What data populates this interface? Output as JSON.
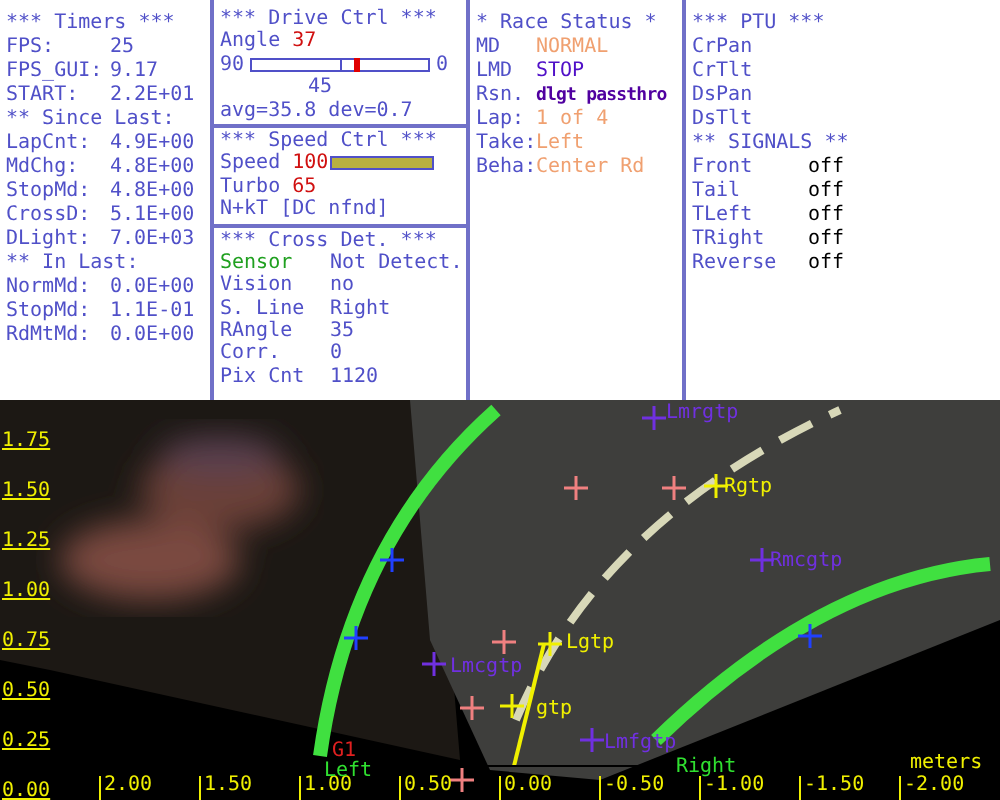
{
  "timers": {
    "title": "*** Timers ***",
    "rows": [
      {
        "kind": "value",
        "label": "FPS:",
        "value": "25"
      },
      {
        "kind": "value",
        "label": "FPS_GUI:",
        "value": "9.17"
      },
      {
        "kind": "value",
        "label": "START:",
        "value": "2.2E+01"
      },
      {
        "kind": "heading",
        "label": "** Since Last:"
      },
      {
        "kind": "value",
        "label": "LapCnt:",
        "value": "4.9E+00"
      },
      {
        "kind": "value",
        "label": "MdChg:",
        "value": "4.8E+00"
      },
      {
        "kind": "value",
        "label": "StopMd:",
        "value": "4.8E+00"
      },
      {
        "kind": "value",
        "label": "CrossD:",
        "value": "5.1E+00"
      },
      {
        "kind": "value",
        "label": "DLight:",
        "value": "7.0E+03"
      },
      {
        "kind": "heading",
        "label": "** In Last:"
      },
      {
        "kind": "value",
        "label": "NormMd:",
        "value": "0.0E+00"
      },
      {
        "kind": "value",
        "label": "StopMd:",
        "value": "1.1E-01"
      },
      {
        "kind": "value",
        "label": "RdMtMd:",
        "value": "0.0E+00"
      }
    ]
  },
  "drive_ctrl": {
    "title": "***  Drive Ctrl  ***",
    "angle_label": "Angle",
    "angle_value": "37",
    "slider": {
      "min_label": "90",
      "max_label": "0",
      "center_label": "45",
      "level": 0.59
    },
    "stats": "avg=35.8  dev=0.7"
  },
  "speed_ctrl": {
    "title": "***  Speed Ctrl  ***",
    "speed_label": "Speed",
    "speed_value": "100",
    "speed_bar": {
      "level": 1.0
    },
    "turbo_label": "Turbo",
    "turbo_value": "65",
    "mode": "N+kT [DC nfnd]"
  },
  "cross_det": {
    "title": "*** Cross Det. ***",
    "rows": [
      {
        "label": "Sensor",
        "value": "Not Detect.",
        "color": "#20a020"
      },
      {
        "label": "Vision",
        "value": "no",
        "color": "#5050c8"
      },
      {
        "label": "S. Line",
        "value": "Right",
        "color": "#5050c8"
      },
      {
        "label": "RAngle",
        "value": "35",
        "color": "#5050c8"
      },
      {
        "label": "Corr.",
        "value": "0",
        "color": "#5050c8"
      },
      {
        "label": "Pix Cnt",
        "value": "1120",
        "color": "#5050c8"
      }
    ]
  },
  "race_status": {
    "title": "* Race Status *",
    "rows": [
      {
        "label": "MD",
        "value": "NORMAL",
        "color": "#f0a070"
      },
      {
        "label": "LMD",
        "value": "STOP",
        "color": "#5010c8"
      },
      {
        "label": "Rsn.",
        "value": "dlgt passthro",
        "color": "#5000a0"
      },
      {
        "label": "Lap:",
        "value": "1 of 4",
        "color": "#f0a070"
      },
      {
        "label": "Take:",
        "value": "Left",
        "color": "#f0a070"
      },
      {
        "label": "Beha:",
        "value": "Center Rd",
        "color": "#f0a070"
      }
    ]
  },
  "ptu": {
    "title": "*** PTU ***",
    "items": [
      "CrPan",
      "CrTlt",
      "DsPan",
      "DsTlt"
    ]
  },
  "signals": {
    "title": "** SIGNALS **",
    "rows": [
      {
        "label": "Front",
        "value": "off"
      },
      {
        "label": "Tail",
        "value": "off"
      },
      {
        "label": "TLeft",
        "value": "off"
      },
      {
        "label": "TRight",
        "value": "off"
      },
      {
        "label": "Reverse",
        "value": "off"
      }
    ]
  },
  "camera_view": {
    "y_ticks": [
      "1.75",
      "1.50",
      "1.25",
      "1.00",
      "0.75",
      "0.50",
      "0.25",
      "0.00"
    ],
    "x_ticks": [
      "2.00",
      "1.50",
      "1.00",
      "0.50",
      "0.00",
      "-0.50",
      "-1.00",
      "-1.50",
      "-2.00"
    ],
    "unit": "meters",
    "markers": [
      {
        "label": "Lmrgtp",
        "color": "#7030e0"
      },
      {
        "label": "Rgtp",
        "color": "#f0f000"
      },
      {
        "label": "Rmcgtp",
        "color": "#7030e0"
      },
      {
        "label": "Lgtp",
        "color": "#f0f000"
      },
      {
        "label": "Lmcgtp",
        "color": "#7030e0"
      },
      {
        "label": "gtp",
        "color": "#f0f000"
      },
      {
        "label": "Lmfgtp",
        "color": "#7030e0"
      },
      {
        "label": "G1",
        "color": "#e02020"
      },
      {
        "label": "Left",
        "color": "#30e030"
      },
      {
        "label": "Right",
        "color": "#30e030"
      }
    ]
  }
}
